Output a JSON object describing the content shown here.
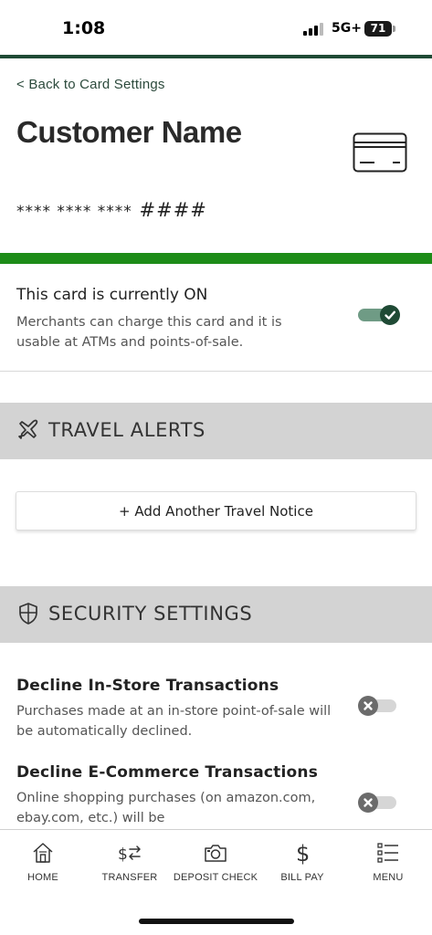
{
  "status_bar": {
    "time": "1:08",
    "network": "5G+",
    "battery": "71"
  },
  "header": {
    "back_label": "< Back to Card Settings",
    "customer_name": "Customer Name",
    "card_number_masked": "**** **** ****",
    "card_number_last": "####",
    "icon": "credit-card-icon"
  },
  "card_status": {
    "title": "This card is currently ON",
    "description": "Merchants can charge this card and it is usable at ATMs and points-of-sale.",
    "enabled": true
  },
  "travel_alerts": {
    "heading": "TRAVEL ALERTS",
    "icon": "airplane-icon",
    "add_button_label": "+ Add Another Travel Notice"
  },
  "security_settings": {
    "heading": "SECURITY SETTINGS",
    "icon": "shield-icon",
    "items": [
      {
        "title": "Decline In-Store Transactions",
        "description": "Purchases made at an in-store point-of-sale will be automatically declined.",
        "enabled": false
      },
      {
        "title": "Decline E-Commerce Transactions",
        "description": "Online shopping purchases (on amazon.com, ebay.com, etc.) will be",
        "enabled": false
      }
    ]
  },
  "bottom_nav": {
    "items": [
      {
        "label": "HOME",
        "icon": "home-icon"
      },
      {
        "label": "TRANSFER",
        "icon": "transfer-icon"
      },
      {
        "label": "DEPOSIT CHECK",
        "icon": "camera-icon"
      },
      {
        "label": "BILL PAY",
        "icon": "dollar-icon"
      },
      {
        "label": "MENU",
        "icon": "menu-list-icon"
      }
    ]
  },
  "colors": {
    "brand_dark_green": "#1f4a35",
    "active_green_bar": "#1d8c18",
    "section_gray": "#d3d3d3"
  }
}
